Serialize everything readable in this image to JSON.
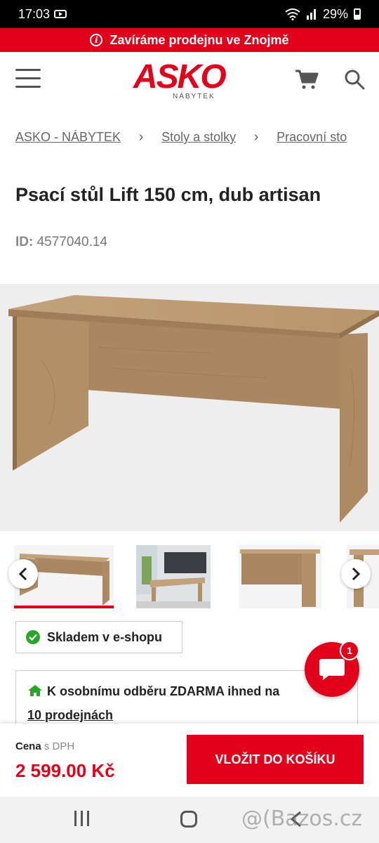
{
  "status_bar": {
    "time": "17:03",
    "battery": "29%"
  },
  "banner": {
    "text": "Zavíráme prodejnu ve Znojmě"
  },
  "header": {
    "logo_text": "ASKO",
    "logo_sub": "NÁBYTEK"
  },
  "breadcrumb": {
    "items": [
      "ASKO - NÁBYTEK",
      "Stoly a stolky",
      "Pracovní sto"
    ]
  },
  "product": {
    "title": "Psací stůl Lift 150 cm, dub artisan",
    "id_label": "ID:",
    "id_value": "4577040.14"
  },
  "stock": {
    "text": "Skladem v e-shopu"
  },
  "pickup": {
    "text": "K osobnímu odběru ZDARMA ihned na",
    "link": "10 prodejnách"
  },
  "chat": {
    "badge": "1"
  },
  "price_bar": {
    "label": "Cena",
    "label_suffix": "s DPH",
    "price": "2 599.00 Kč",
    "add_button": "VLOŽIT DO KOŠÍKU"
  },
  "watermark": "@(Bazos.cz",
  "colors": {
    "brand_red": "#e3001b",
    "wood": "#b4926a",
    "check_green": "#2aa52a"
  }
}
